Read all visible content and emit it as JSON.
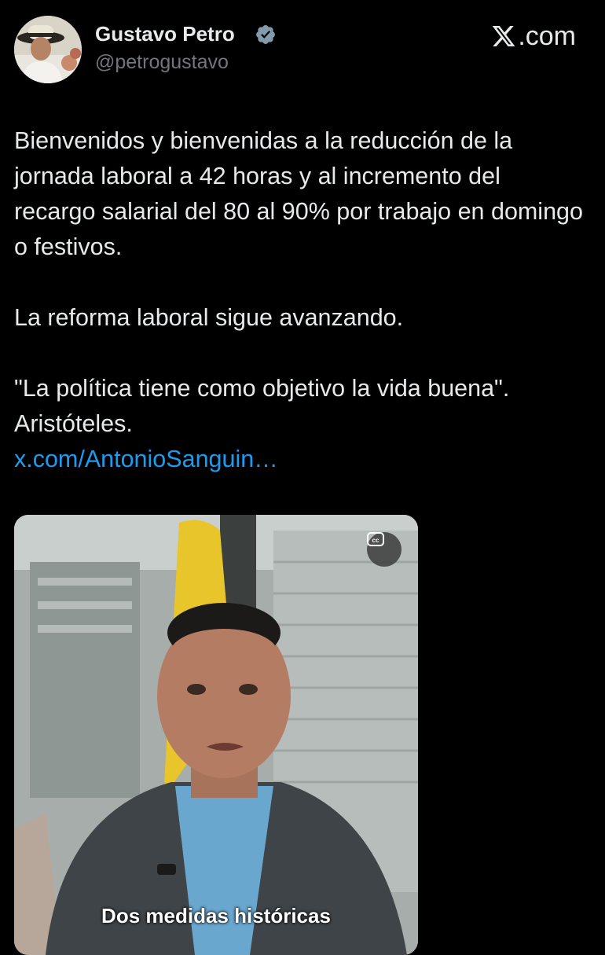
{
  "author": {
    "display_name": "Gustavo Petro",
    "handle": "@petrogustavo",
    "verified_icon": "verified-badge-icon",
    "avatar_icon": "avatar-photo"
  },
  "brand": {
    "label": ".com",
    "icon": "x-logo-icon"
  },
  "tweet": {
    "paragraph1": "Bienvenidos y bienvenidas a la reducción de la jornada laboral a 42 horas y al incremento del recargo salarial del 80 al 90% por trabajo en domingo o festivos.",
    "paragraph2": "La reforma laboral sigue avanzando.",
    "quote": "\"La política tiene como objetivo la vida buena\".",
    "quote_author": "Aristóteles.",
    "link": "x.com/AntonioSanguin…"
  },
  "media": {
    "caption": "Dos medidas históricas",
    "cc_icon": "closed-captions-icon"
  },
  "colors": {
    "background": "#000000",
    "text": "#e7e9ea",
    "secondary_text": "#71767b",
    "link": "#1d9bf0",
    "verified": "#829aab"
  }
}
